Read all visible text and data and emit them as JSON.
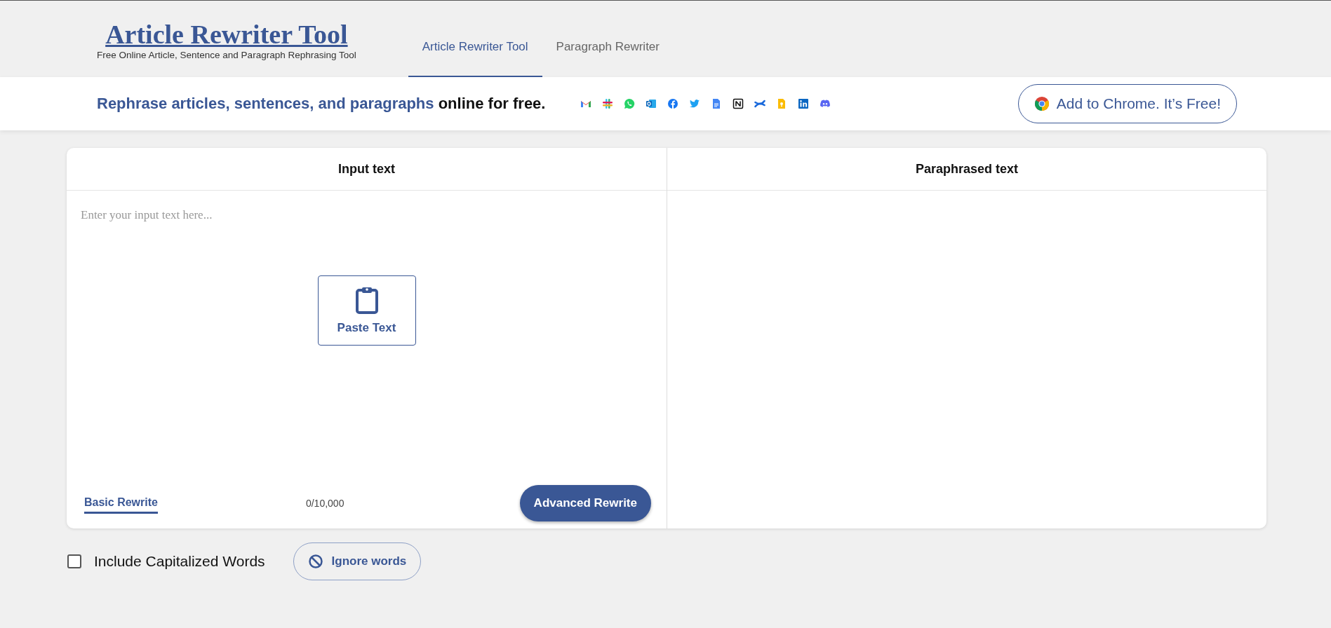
{
  "header": {
    "logo": "Article Rewriter Tool",
    "tagline": "Free Online Article, Sentence and Paragraph Rephrasing Tool",
    "nav": [
      {
        "label": "Article Rewriter Tool",
        "selected": true
      },
      {
        "label": "Paragraph Rewriter",
        "selected": false
      }
    ]
  },
  "banner": {
    "headline_highlight": "Rephrase articles, sentences, and paragraphs",
    "headline_rest": "online for free.",
    "share_icons": [
      {
        "kind": "mail"
      },
      {
        "kind": "slack"
      },
      {
        "kind": "whatsapp"
      },
      {
        "kind": "outlook"
      },
      {
        "kind": "facebook"
      },
      {
        "kind": "twitter"
      },
      {
        "kind": "docs"
      },
      {
        "kind": "notion"
      },
      {
        "kind": "confluence"
      },
      {
        "kind": "keep"
      },
      {
        "kind": "linkedin"
      },
      {
        "kind": "discord"
      }
    ],
    "chrome_button": "Add to Chrome. It’s Free!"
  },
  "editor": {
    "input_title": "Input text",
    "output_title": "Paraphrased text",
    "placeholder": "Enter your input text here...",
    "paste_button": "Paste Text",
    "basic_mode": {
      "label": "Basic Rewrite",
      "selected": true
    },
    "counter": "0/10,000",
    "advanced_button": "Advanced Rewrite"
  },
  "options": {
    "checkbox": {
      "label": "Include Capitalized Words",
      "checked": false
    },
    "ignore_button": "Ignore words"
  }
}
